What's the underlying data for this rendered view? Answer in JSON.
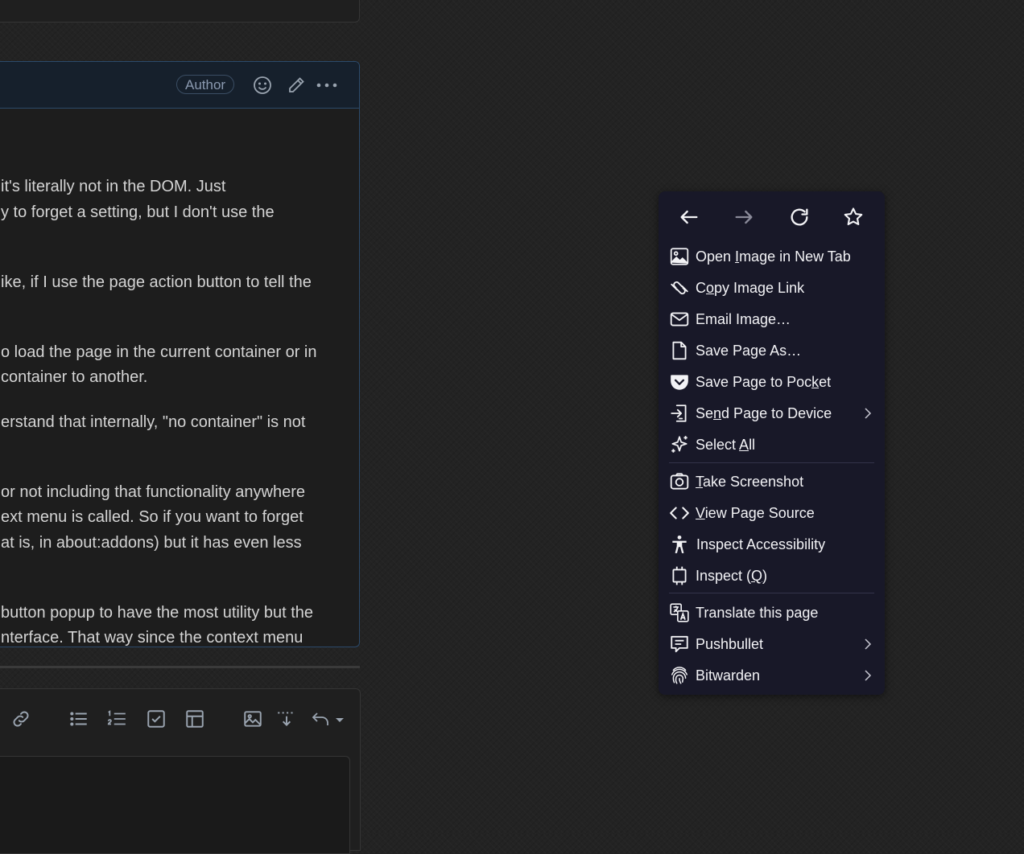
{
  "comment": {
    "badge": "Author",
    "lines": [
      "it's literally not in the DOM. Just",
      "y to forget a setting, but I don't use the",
      "ike, if I use the page action button to tell the",
      "o load the page in the current container or in",
      "container to another.",
      "erstand that internally, \"no container\" is not",
      "or not including that functionality anywhere",
      "ext menu is called. So if you want to forget",
      "at is, in about:addons) but it has even less",
      "button popup to have the most utility but the",
      "nterface. That way since the context menu"
    ]
  },
  "context_menu": {
    "nav": [
      "back-icon",
      "forward-icon",
      "reload-icon",
      "bookmark-star-icon"
    ],
    "items": [
      {
        "pre": "Open ",
        "acc": "I",
        "post": "mage in New Tab",
        "icon": "image-icon"
      },
      {
        "pre": "C",
        "acc": "o",
        "post": "py Image Link",
        "icon": "link-icon"
      },
      {
        "pre": "Email Ima",
        "acc": "g",
        "post": "e…",
        "icon": "mail-icon"
      },
      {
        "pre": "Save Page As…",
        "acc": "",
        "post": "",
        "icon": "page-icon"
      },
      {
        "pre": "Save Page to Poc",
        "acc": "k",
        "post": "et",
        "icon": "pocket-icon"
      },
      {
        "pre": "Se",
        "acc": "n",
        "post": "d Page to Device",
        "icon": "send-device-icon"
      },
      {
        "pre": "Select ",
        "acc": "A",
        "post": "ll",
        "icon": "sparkle-icon"
      },
      {
        "pre": "",
        "acc": "T",
        "post": "ake Screenshot",
        "icon": "camera-icon"
      },
      {
        "pre": "",
        "acc": "V",
        "post": "iew Page Source",
        "icon": "code-icon"
      },
      {
        "pre": "Inspect Accessibility",
        "acc": "",
        "post": "",
        "icon": "accessibility-icon"
      },
      {
        "pre": "Inspect (",
        "acc": "Q",
        "post": ")",
        "icon": "inspect-icon"
      },
      {
        "pre": "Translate this page",
        "acc": "",
        "post": "",
        "icon": "translate-icon"
      },
      {
        "pre": "Pushbullet",
        "acc": "",
        "post": "",
        "icon": "pushbullet-icon"
      },
      {
        "pre": "Bitwarden",
        "acc": "",
        "post": "",
        "icon": "fingerprint-icon"
      }
    ]
  }
}
